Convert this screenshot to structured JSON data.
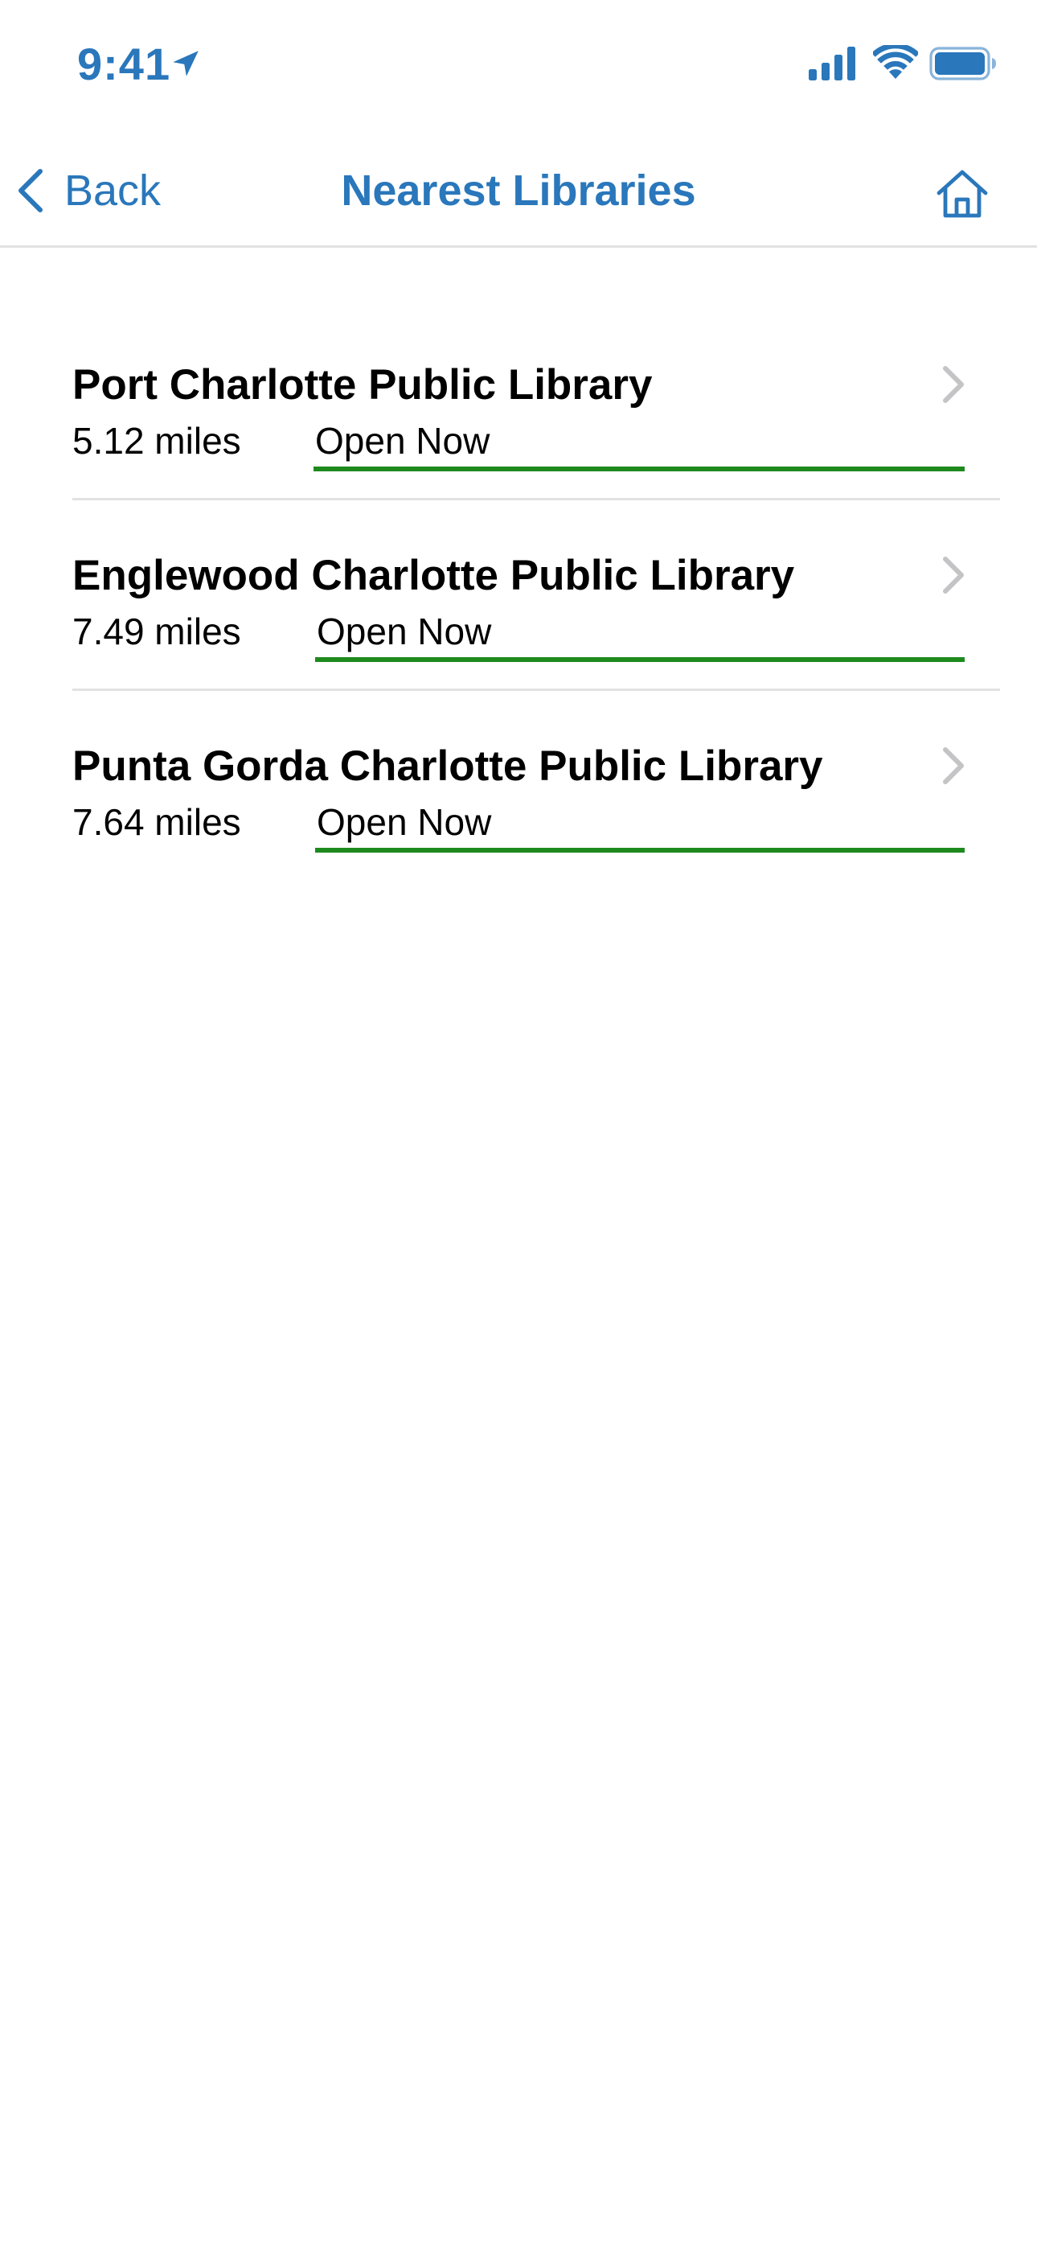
{
  "status_bar": {
    "time": "9:41",
    "location_icon": "location-arrow-icon",
    "signal_icon": "cellular-signal-icon",
    "wifi_icon": "wifi-icon",
    "battery_icon": "battery-icon"
  },
  "nav": {
    "back_label": "Back",
    "title": "Nearest Libraries",
    "home_icon": "home-icon"
  },
  "libraries": [
    {
      "name": "Port Charlotte Public Library",
      "distance": "5.12 miles",
      "status": "Open Now"
    },
    {
      "name": "Englewood Charlotte Public Library",
      "distance": "7.49 miles",
      "status": "Open Now"
    },
    {
      "name": "Punta Gorda Charlotte Public Library",
      "distance": "7.64 miles",
      "status": "Open Now"
    }
  ],
  "colors": {
    "accent": "#2a77bb",
    "open_status": "#1e8a1e",
    "divider": "#e2e2e2",
    "chevron": "#c4c4c6"
  }
}
